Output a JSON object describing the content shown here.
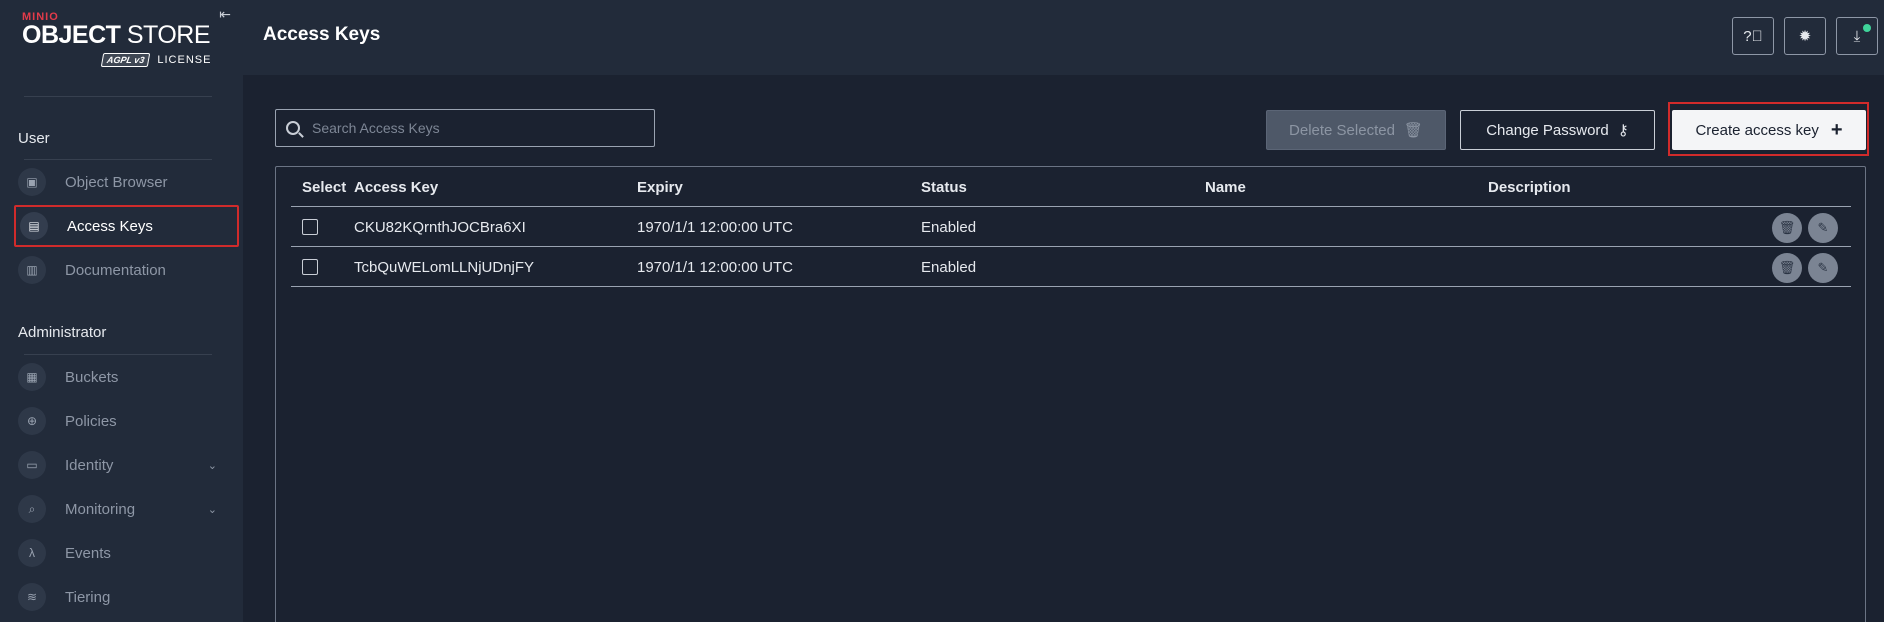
{
  "sidebar": {
    "logo": {
      "brand": "MINIO",
      "product_bold": "OBJECT",
      "product_light": " STORE",
      "license_badge": "AGPL v3",
      "license_text": "LICENSE"
    },
    "sections": [
      {
        "title": "User"
      },
      {
        "title": "Administrator"
      }
    ],
    "items": [
      {
        "label": "Object Browser",
        "icon": "object-browser-icon"
      },
      {
        "label": "Access Keys",
        "icon": "access-keys-icon",
        "active": true
      },
      {
        "label": "Documentation",
        "icon": "documentation-icon"
      },
      {
        "label": "Buckets",
        "icon": "buckets-icon"
      },
      {
        "label": "Policies",
        "icon": "policies-icon"
      },
      {
        "label": "Identity",
        "icon": "identity-icon",
        "expandable": true
      },
      {
        "label": "Monitoring",
        "icon": "monitoring-icon",
        "expandable": true
      },
      {
        "label": "Events",
        "icon": "lambda-icon"
      },
      {
        "label": "Tiering",
        "icon": "tiering-icon"
      }
    ]
  },
  "header": {
    "title": "Access Keys",
    "buttons": [
      "help-icon",
      "theme-icon",
      "download-icon"
    ]
  },
  "toolbar": {
    "search_placeholder": "Search Access Keys",
    "delete_label": "Delete Selected",
    "change_password_label": "Change Password",
    "create_label": "Create access key"
  },
  "table": {
    "columns": [
      "Select",
      "Access Key",
      "Expiry",
      "Status",
      "Name",
      "Description"
    ],
    "rows": [
      {
        "access_key": "CKU82KQrnthJOCBra6XI",
        "expiry": "1970/1/1 12:00:00 UTC",
        "status": "Enabled",
        "name": "",
        "description": ""
      },
      {
        "access_key": "TcbQuWELomLLNjUDnjFY",
        "expiry": "1970/1/1 12:00:00 UTC",
        "status": "Enabled",
        "name": "",
        "description": ""
      }
    ]
  },
  "colors": {
    "accent_highlight": "#d12b2b",
    "status_dot": "#3fd49a",
    "background": "#1b2230",
    "sidebar": "#222b3a"
  }
}
